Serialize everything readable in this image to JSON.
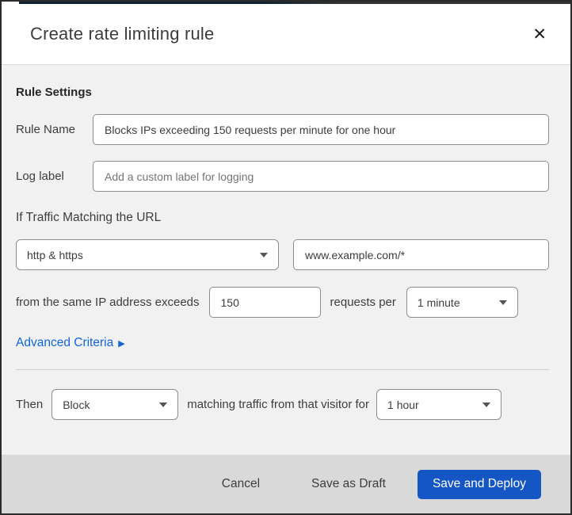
{
  "dialog": {
    "title": "Create rate limiting rule",
    "close_icon": "✕"
  },
  "rule_settings": {
    "heading": "Rule Settings",
    "rule_name_label": "Rule Name",
    "rule_name_value": "Blocks IPs exceeding 150 requests per minute for one hour",
    "log_label_label": "Log label",
    "log_label_placeholder": "Add a custom label for logging"
  },
  "match": {
    "intro": "If Traffic Matching the URL",
    "scheme_value": "http & https",
    "url_value": "www.example.com/*",
    "threshold_prefix": "from the same IP address exceeds",
    "threshold_value": "150",
    "threshold_suffix": "requests per",
    "period_value": "1 minute",
    "advanced_link": "Advanced Criteria",
    "advanced_arrow": "▶"
  },
  "action": {
    "then_label": "Then",
    "action_value": "Block",
    "middle_text": "matching traffic from that visitor for",
    "duration_value": "1 hour"
  },
  "footer": {
    "cancel_label": "Cancel",
    "draft_label": "Save as Draft",
    "deploy_label": "Save and Deploy"
  },
  "colors": {
    "accent_blue": "#1556c5",
    "link_blue": "#1065d8",
    "body_bg": "#f1f1f1",
    "footer_bg": "#d9d9d9",
    "border_gray": "#8d8d8d"
  }
}
